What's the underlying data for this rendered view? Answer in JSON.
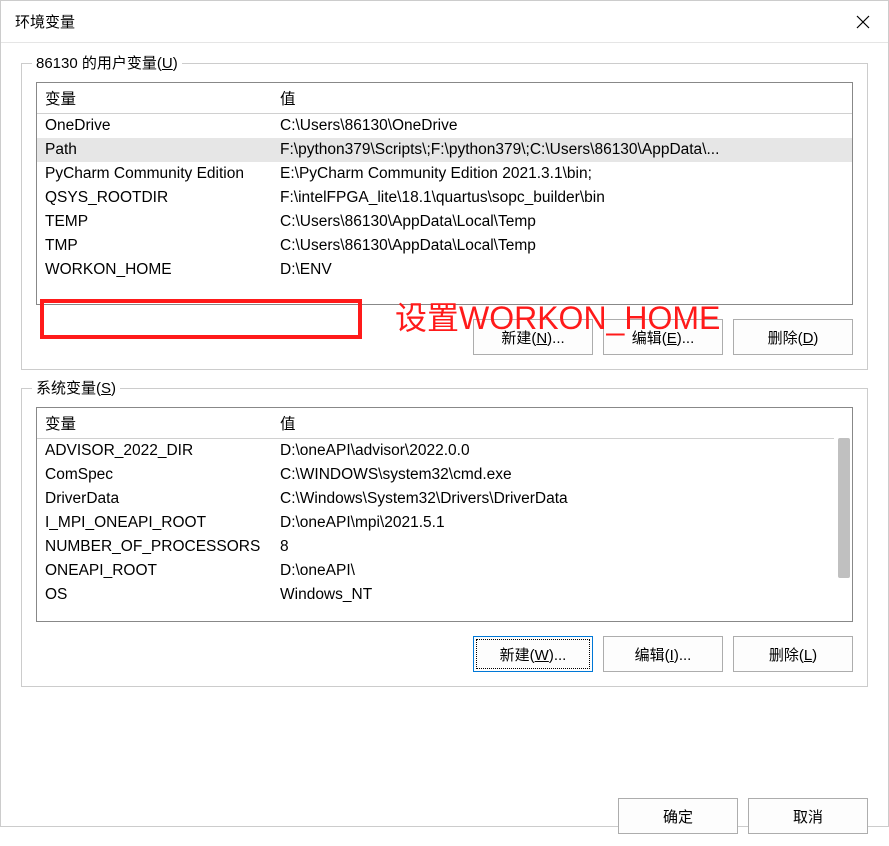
{
  "dialog": {
    "title": "环境变量"
  },
  "userVars": {
    "label": "86130 的用户变量",
    "shortcut": "U",
    "headers": {
      "name": "变量",
      "value": "值"
    },
    "rows": [
      {
        "name": "OneDrive",
        "value": "C:\\Users\\86130\\OneDrive",
        "selected": false
      },
      {
        "name": "Path",
        "value": "F:\\python379\\Scripts\\;F:\\python379\\;C:\\Users\\86130\\AppData\\...",
        "selected": true
      },
      {
        "name": "PyCharm Community Edition",
        "value": "E:\\PyCharm Community Edition 2021.3.1\\bin;",
        "selected": false
      },
      {
        "name": "QSYS_ROOTDIR",
        "value": "F:\\intelFPGA_lite\\18.1\\quartus\\sopc_builder\\bin",
        "selected": false
      },
      {
        "name": "TEMP",
        "value": "C:\\Users\\86130\\AppData\\Local\\Temp",
        "selected": false
      },
      {
        "name": "TMP",
        "value": "C:\\Users\\86130\\AppData\\Local\\Temp",
        "selected": false
      },
      {
        "name": "WORKON_HOME",
        "value": "D:\\ENV",
        "selected": false
      }
    ],
    "buttons": {
      "new": {
        "label": "新建",
        "shortcut": "N",
        "suffix": "..."
      },
      "edit": {
        "label": "编辑",
        "shortcut": "E",
        "suffix": "..."
      },
      "delete": {
        "label": "删除",
        "shortcut": "D",
        "suffix": ""
      }
    }
  },
  "sysVars": {
    "label": "系统变量",
    "shortcut": "S",
    "headers": {
      "name": "变量",
      "value": "值"
    },
    "rows": [
      {
        "name": "ADVISOR_2022_DIR",
        "value": "D:\\oneAPI\\advisor\\2022.0.0"
      },
      {
        "name": "ComSpec",
        "value": "C:\\WINDOWS\\system32\\cmd.exe"
      },
      {
        "name": "DriverData",
        "value": "C:\\Windows\\System32\\Drivers\\DriverData"
      },
      {
        "name": "I_MPI_ONEAPI_ROOT",
        "value": "D:\\oneAPI\\mpi\\2021.5.1"
      },
      {
        "name": "NUMBER_OF_PROCESSORS",
        "value": "8"
      },
      {
        "name": "ONEAPI_ROOT",
        "value": "D:\\oneAPI\\"
      },
      {
        "name": "OS",
        "value": "Windows_NT"
      }
    ],
    "buttons": {
      "new": {
        "label": "新建",
        "shortcut": "W",
        "suffix": "..."
      },
      "edit": {
        "label": "编辑",
        "shortcut": "I",
        "suffix": "..."
      },
      "delete": {
        "label": "删除",
        "shortcut": "L",
        "suffix": ""
      }
    }
  },
  "annotation": {
    "text": "设置WORKON_HOME"
  },
  "footer": {
    "ok": "确定",
    "cancel": "取消"
  }
}
